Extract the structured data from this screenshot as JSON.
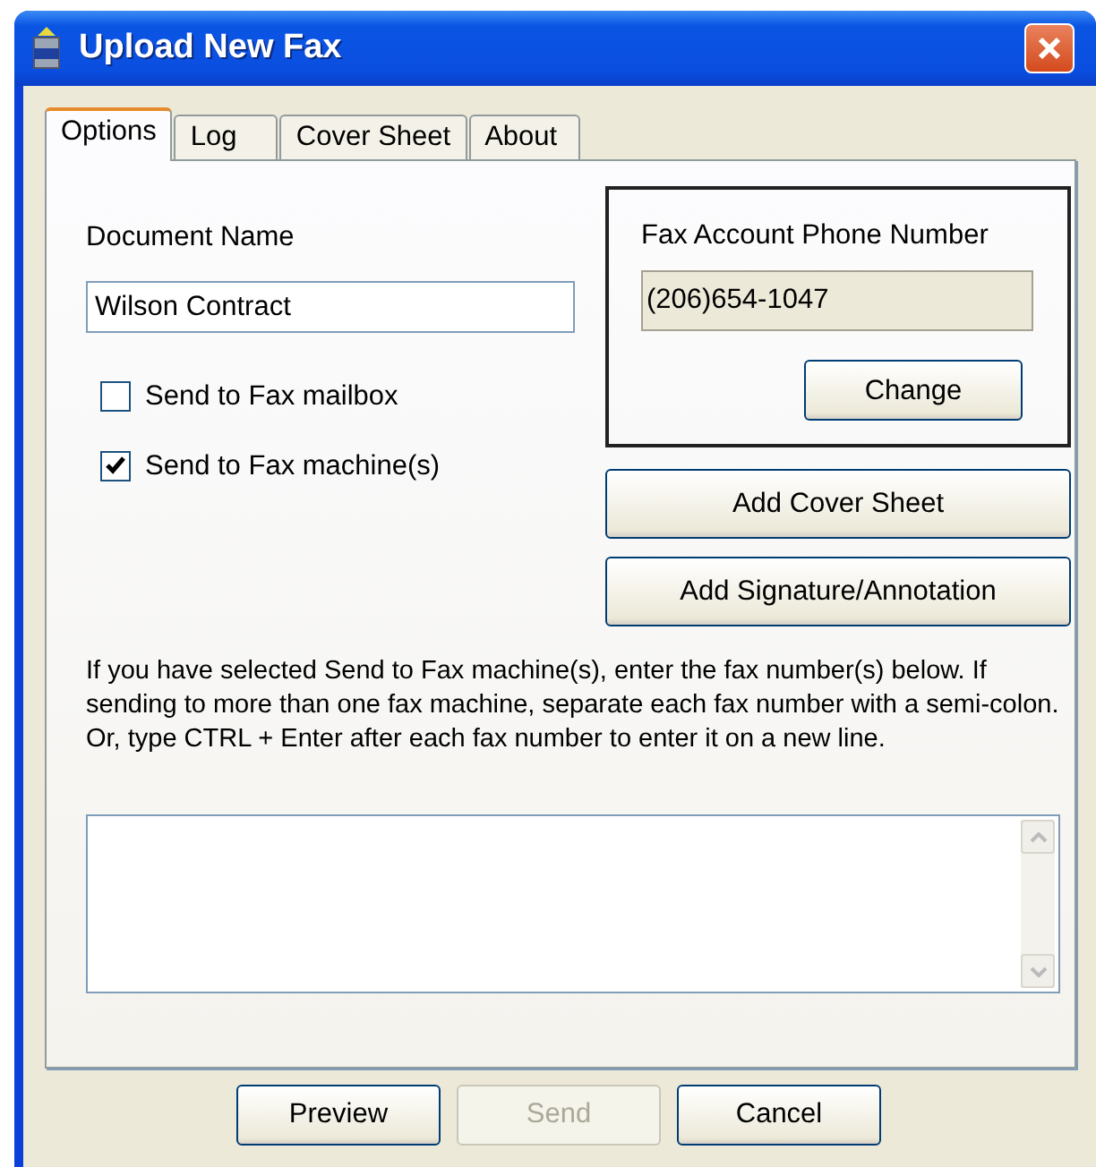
{
  "window": {
    "title": "Upload New Fax"
  },
  "tabs": [
    {
      "label": "Options",
      "selected": true
    },
    {
      "label": "Log",
      "selected": false
    },
    {
      "label": "Cover Sheet",
      "selected": false
    },
    {
      "label": "About",
      "selected": false
    }
  ],
  "document_name": {
    "label": "Document Name",
    "value": "Wilson Contract"
  },
  "options": [
    {
      "label": "Send to Fax mailbox",
      "checked": false
    },
    {
      "label": "Send to Fax machine(s)",
      "checked": true
    }
  ],
  "account": {
    "label": "Fax Account Phone Number",
    "value": "(206)654-1047",
    "button": "Change"
  },
  "side_buttons": [
    "Add Cover Sheet",
    "Add Signature/Annotation"
  ],
  "instructions": "If you have selected Send to Fax machine(s), enter the fax number(s) below.  If sending to more than one fax machine, separate each fax number with a semi-colon.  Or, type CTRL + Enter after each fax number to enter it on a new line.",
  "buttons": [
    {
      "label": "Preview",
      "disabled": false
    },
    {
      "label": "Send",
      "disabled": true
    },
    {
      "label": "Cancel",
      "disabled": false
    }
  ]
}
